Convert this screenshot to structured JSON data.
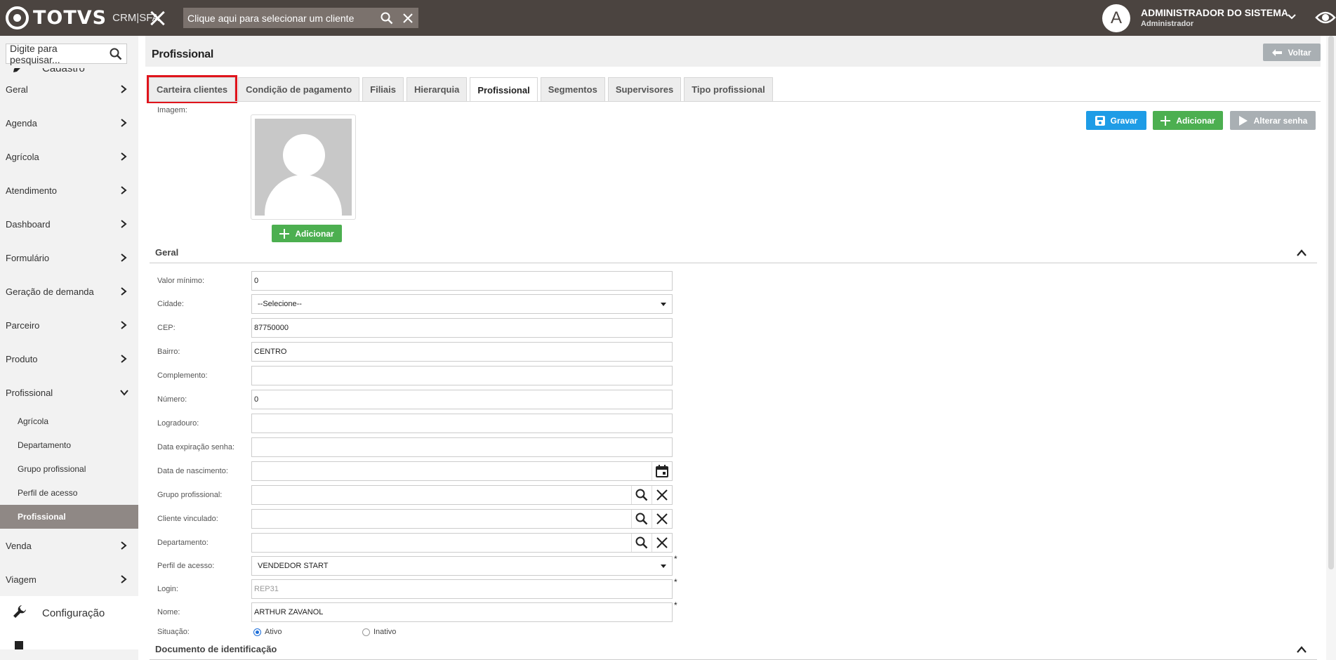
{
  "topbar": {
    "logo_text": "TOTVS",
    "logo_sub": "CRM|SFA",
    "client_search_placeholder": "Clique aqui para selecionar um cliente",
    "user_initial": "A",
    "user_name": "ADMINISTRADOR DO SISTEMA",
    "user_role": "Administrador"
  },
  "sidebar": {
    "search_placeholder": "Digite para pesquisar...",
    "section_cadastro": "Cadastro",
    "items": [
      {
        "label": "Geral"
      },
      {
        "label": "Agenda"
      },
      {
        "label": "Agrícola"
      },
      {
        "label": "Atendimento"
      },
      {
        "label": "Dashboard"
      },
      {
        "label": "Formulário"
      },
      {
        "label": "Geração de demanda"
      },
      {
        "label": "Parceiro"
      },
      {
        "label": "Produto"
      },
      {
        "label": "Profissional"
      }
    ],
    "subitems": [
      {
        "label": "Agrícola"
      },
      {
        "label": "Departamento"
      },
      {
        "label": "Grupo profissional"
      },
      {
        "label": "Perfil de acesso"
      },
      {
        "label": "Profissional"
      }
    ],
    "items_after": [
      {
        "label": "Venda"
      },
      {
        "label": "Viagem"
      }
    ],
    "section_configuracao": "Configuração"
  },
  "main": {
    "page_title": "Profissional",
    "voltar_label": "Voltar",
    "tabs": [
      {
        "label": "Carteira clientes"
      },
      {
        "label": "Condição de pagamento"
      },
      {
        "label": "Filiais"
      },
      {
        "label": "Hierarquia"
      },
      {
        "label": "Profissional"
      },
      {
        "label": "Segmentos"
      },
      {
        "label": "Supervisores"
      },
      {
        "label": "Tipo profissional"
      }
    ],
    "image_label": "Imagem:",
    "add_image_label": "Adicionar",
    "gravar_label": "Gravar",
    "adicionar_label": "Adicionar",
    "alterar_senha_label": "Alterar senha",
    "section_geral": "Geral",
    "section_documento": "Documento de identificação",
    "form": {
      "valor_minimo": {
        "label": "Valor mínimo:",
        "value": "0"
      },
      "cidade": {
        "label": "Cidade:",
        "value": "--Selecione--"
      },
      "cep": {
        "label": "CEP:",
        "value": "87750000"
      },
      "bairro": {
        "label": "Bairro:",
        "value": "CENTRO"
      },
      "complemento": {
        "label": "Complemento:",
        "value": ""
      },
      "numero": {
        "label": "Número:",
        "value": "0"
      },
      "logradouro": {
        "label": "Logradouro:",
        "value": ""
      },
      "data_expiracao": {
        "label": "Data expiração senha:",
        "value": ""
      },
      "data_nascimento": {
        "label": "Data de nascimento:",
        "value": ""
      },
      "grupo_profissional": {
        "label": "Grupo profissional:",
        "value": ""
      },
      "cliente_vinculado": {
        "label": "Cliente vinculado:",
        "value": ""
      },
      "departamento": {
        "label": "Departamento:",
        "value": ""
      },
      "perfil_acesso": {
        "label": "Perfil de acesso:",
        "value": "VENDEDOR START"
      },
      "login": {
        "label": "Login:",
        "value": "REP31"
      },
      "nome": {
        "label": "Nome:",
        "value": "ARTHUR ZAVANOL"
      },
      "situacao": {
        "label": "Situação:",
        "option_ativo": "Ativo",
        "option_inativo": "Inativo",
        "selected": "Ativo"
      }
    },
    "required_mark": "*"
  }
}
